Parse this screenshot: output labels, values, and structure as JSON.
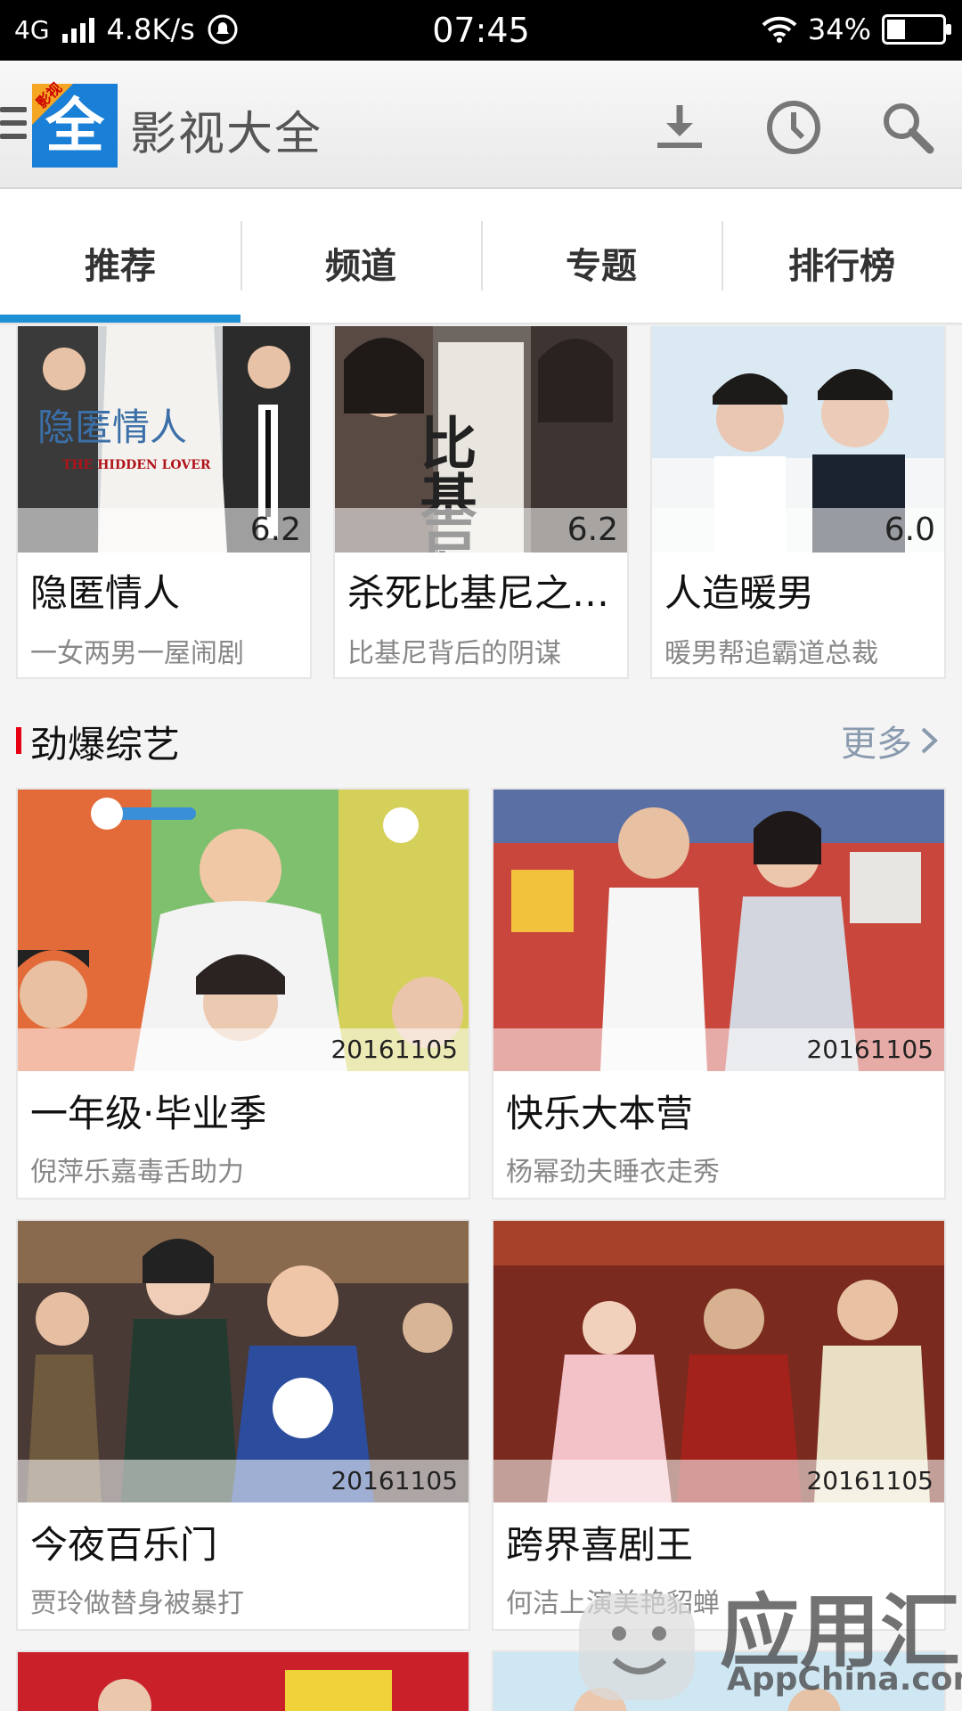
{
  "status_bar": {
    "network": "4G",
    "speed": "4.8K/s",
    "time": "07:45",
    "battery": "34%",
    "battery_level": 0.34
  },
  "app_bar": {
    "logo_text": "全",
    "logo_badge": "影视",
    "title": "影视大全",
    "actions": [
      "download-icon",
      "history-clock-icon",
      "search-icon"
    ]
  },
  "tabs": [
    {
      "label": "推荐",
      "active": true
    },
    {
      "label": "频道",
      "active": false
    },
    {
      "label": "专题",
      "active": false
    },
    {
      "label": "排行榜",
      "active": false
    }
  ],
  "movies": [
    {
      "title": "隐匿情人",
      "subtitle": "一女两男一屋闹剧",
      "score": "6.2",
      "poster_caption": "隐匿情人",
      "poster_caption_en": "THE HIDDEN LOVER"
    },
    {
      "title": "杀死比基尼之…",
      "subtitle": "比基尼背后的阴谋",
      "score": "6.2",
      "poster_caption": "比基尼"
    },
    {
      "title": "人造暖男",
      "subtitle": "暖男帮追霸道总裁",
      "score": "6.0"
    }
  ],
  "variety_section": {
    "title": "劲爆综艺",
    "more_label": "更多",
    "items": [
      {
        "title": "一年级·毕业季",
        "subtitle": "倪萍乐嘉毒舌助力",
        "date": "20161105"
      },
      {
        "title": "快乐大本营",
        "subtitle": "杨幂劲夫睡衣走秀",
        "date": "20161105"
      },
      {
        "title": "今夜百乐门",
        "subtitle": "贾玲做替身被暴打",
        "date": "20161105"
      },
      {
        "title": "跨界喜剧王",
        "subtitle": "何洁上演美艳貂蝉",
        "date": "20161105"
      }
    ]
  },
  "watermark": {
    "text": "应用汇",
    "sub": "AppChina.com"
  },
  "colors": {
    "accent": "#1e90d6",
    "section_marker": "#e60012",
    "more_link": "#8a9aae"
  }
}
